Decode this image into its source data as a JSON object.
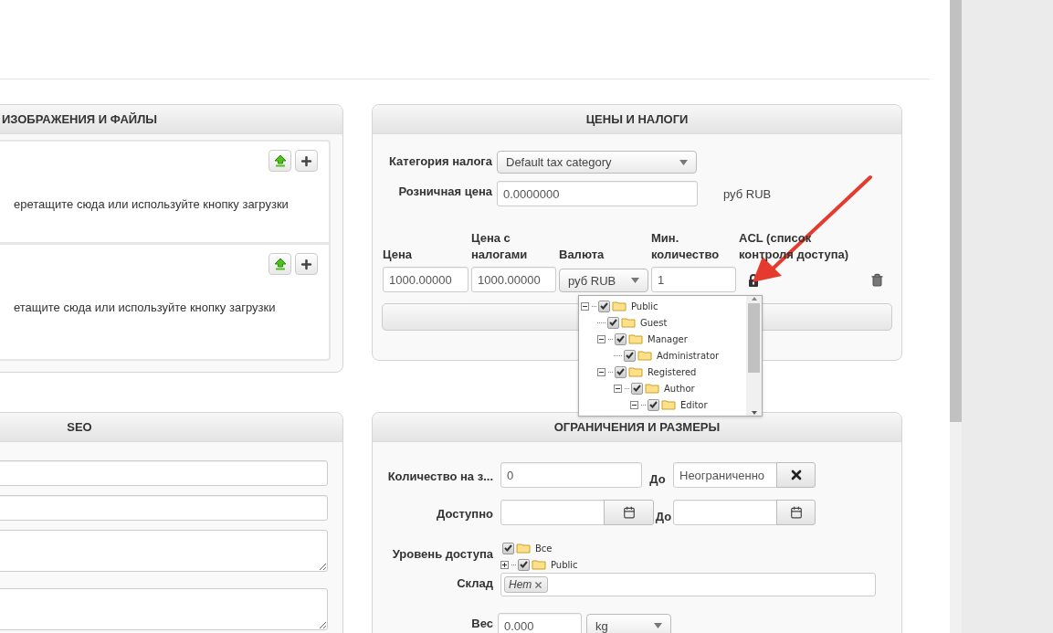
{
  "media": {
    "title": "ИЗОБРАЖЕНИЯ И ФАЙЛЫ",
    "dropzones": [
      {
        "hint": "еретащите сюда или используйте кнопку загрузки"
      },
      {
        "hint": "етащите сюда или используйте кнопку загрузки"
      }
    ]
  },
  "seo": {
    "title": "SEO",
    "fields": [
      {
        "kind": "input"
      },
      {
        "kind": "input"
      },
      {
        "kind": "textarea"
      },
      {
        "kind": "textarea"
      }
    ]
  },
  "prices": {
    "title": "ЦЕНЫ И НАЛОГИ",
    "tax_category": {
      "label": "Категория налога",
      "value": "Default tax category"
    },
    "retail_price": {
      "label": "Розничная цена",
      "value": "0.0000000",
      "currency": "руб RUB"
    },
    "columns": [
      "Цена",
      "Цена с налогами",
      "Валюта",
      "Мин. количество",
      "ACL (список контроля доступа)"
    ],
    "row": {
      "price": "1000.00000",
      "price_with_tax": "1000.00000",
      "currency": "руб RUB",
      "min_quantity": "1"
    },
    "acl_tree": [
      {
        "label": "Public",
        "checked": true,
        "expanded": true,
        "children": [
          {
            "label": "Guest",
            "checked": true
          },
          {
            "label": "Manager",
            "checked": true,
            "expanded": true,
            "children": [
              {
                "label": "Administrator",
                "checked": true
              }
            ]
          },
          {
            "label": "Registered",
            "checked": true,
            "expanded": true,
            "children": [
              {
                "label": "Author",
                "checked": true,
                "expanded": true,
                "children": [
                  {
                    "label": "Editor",
                    "checked": true,
                    "expanded": true
                  }
                ]
              }
            ]
          }
        ]
      }
    ]
  },
  "limits": {
    "title": "ОГРАНИЧЕНИЯ И РАЗМЕРЫ",
    "stock": {
      "label": "Количество на з...",
      "value": "0",
      "to_label": "До",
      "to_value": "Неограниченно"
    },
    "available": {
      "label": "Доступно",
      "to_label": "До"
    },
    "access_level": {
      "label": "Уровень доступа",
      "tree": [
        {
          "label": "Все",
          "checked": true
        },
        {
          "label": "Public",
          "checked": true,
          "expanded": false
        }
      ]
    },
    "warehouse": {
      "label": "Склад",
      "tags": [
        "Нет"
      ]
    },
    "weight": {
      "label": "Вес",
      "value": "0.000",
      "unit": "kg"
    }
  }
}
